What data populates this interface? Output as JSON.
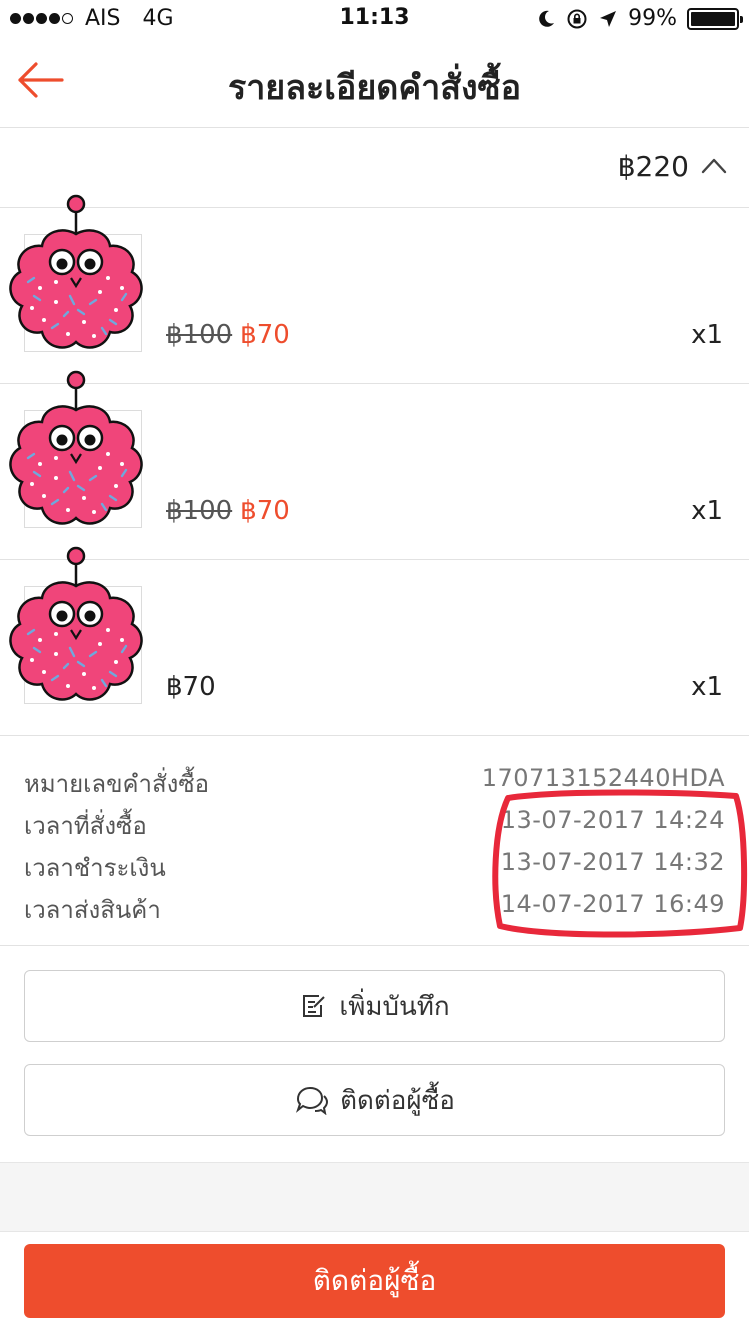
{
  "status_bar": {
    "carrier": "AIS",
    "network": "4G",
    "time": "11:13",
    "battery": "99%"
  },
  "header": {
    "title": "รายละเอียดคำสั่งซื้อ"
  },
  "order": {
    "total": "฿220",
    "items": [
      {
        "old_price": "฿100",
        "price": "฿70",
        "quantity": "x1"
      },
      {
        "old_price": "฿100",
        "price": "฿70",
        "quantity": "x1"
      },
      {
        "price": "฿70",
        "quantity": "x1"
      }
    ]
  },
  "info": {
    "order_number_label": "หมายเลขคำสั่งซื้อ",
    "order_number": "170713152440HDA",
    "order_time_label": "เวลาที่สั่งซื้อ",
    "order_time": "13-07-2017 14:24",
    "payment_time_label": "เวลาชำระเงิน",
    "payment_time": "13-07-2017 14:32",
    "ship_time_label": "เวลาส่งสินค้า",
    "ship_time": "14-07-2017 16:49"
  },
  "actions": {
    "add_note": "เพิ่มบันทึก",
    "contact_buyer": "ติดต่อผู้ซื้อ",
    "primary_contact": "ติดต่อผู้ซื้อ"
  },
  "colors": {
    "accent": "#ee4d2d",
    "annotation": "#e8283a",
    "product_pink": "#f0457a"
  },
  "icons": {
    "back": "arrow-left-icon",
    "collapse": "chevron-up-icon",
    "note": "note-edit-icon",
    "chat": "chat-bubbles-icon"
  }
}
